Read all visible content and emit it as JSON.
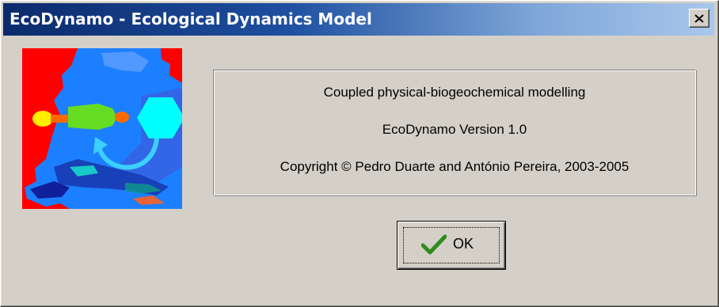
{
  "window": {
    "title": "EcoDynamo - Ecological Dynamics Model",
    "close_label": "×"
  },
  "logo": {
    "icon": "ecodynamo-logo-icon"
  },
  "info": {
    "line1": "Coupled physical-biogeochemical modelling",
    "line2": "EcoDynamo Version 1.0",
    "line3": "Copyright © Pedro Duarte and António Pereira, 2003-2005"
  },
  "ok_button": {
    "label": "OK",
    "icon": "checkmark-icon"
  },
  "colors": {
    "title_gradient_start": "#0b2a6b",
    "title_gradient_end": "#a9c7ec",
    "dialog_face": "#d4d0c8",
    "checkmark": "#2e8b1e"
  }
}
